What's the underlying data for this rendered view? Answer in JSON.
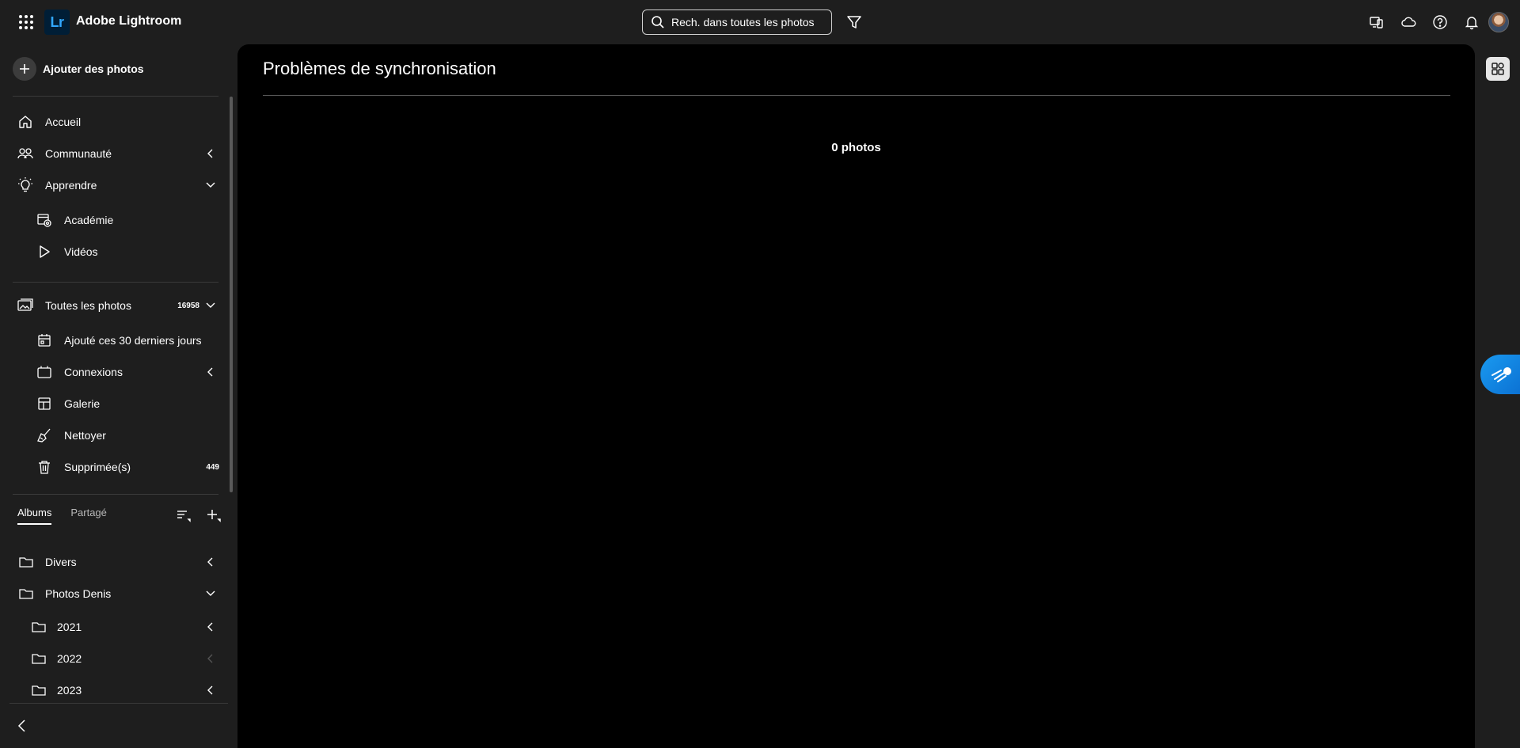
{
  "app": {
    "title": "Adobe Lightroom",
    "logo_text": "Lr"
  },
  "search": {
    "placeholder": "Rech. dans toutes les photos"
  },
  "top_icons": [
    "devices-icon",
    "cloud-icon",
    "help-icon",
    "bell-icon",
    "avatar"
  ],
  "sidebar": {
    "add_photos_label": "Ajouter des photos",
    "nav": {
      "accueil": "Accueil",
      "communaute": "Communauté",
      "apprendre": "Apprendre",
      "academie": "Académie",
      "videos": "Vidéos"
    },
    "library": {
      "all_photos": "Toutes les photos",
      "all_photos_count": "16958",
      "recent": "Ajouté ces 30 derniers jours",
      "connexions": "Connexions",
      "galerie": "Galerie",
      "nettoyer": "Nettoyer",
      "deleted": "Supprimée(s)",
      "deleted_count": "449"
    },
    "tabs": {
      "albums": "Albums",
      "shared": "Partagé"
    },
    "albums": {
      "divers": "Divers",
      "photos_denis": "Photos Denis",
      "y2021": "2021",
      "y2022": "2022",
      "y2023": "2023"
    }
  },
  "main": {
    "title": "Problèmes de synchronisation",
    "photo_count": "0 photos"
  },
  "colors": {
    "background": "#1e1e1e",
    "panel": "#000000",
    "accent": "#31a8ff",
    "logo_bg": "#001e36",
    "help_fab": "#1473e6"
  }
}
